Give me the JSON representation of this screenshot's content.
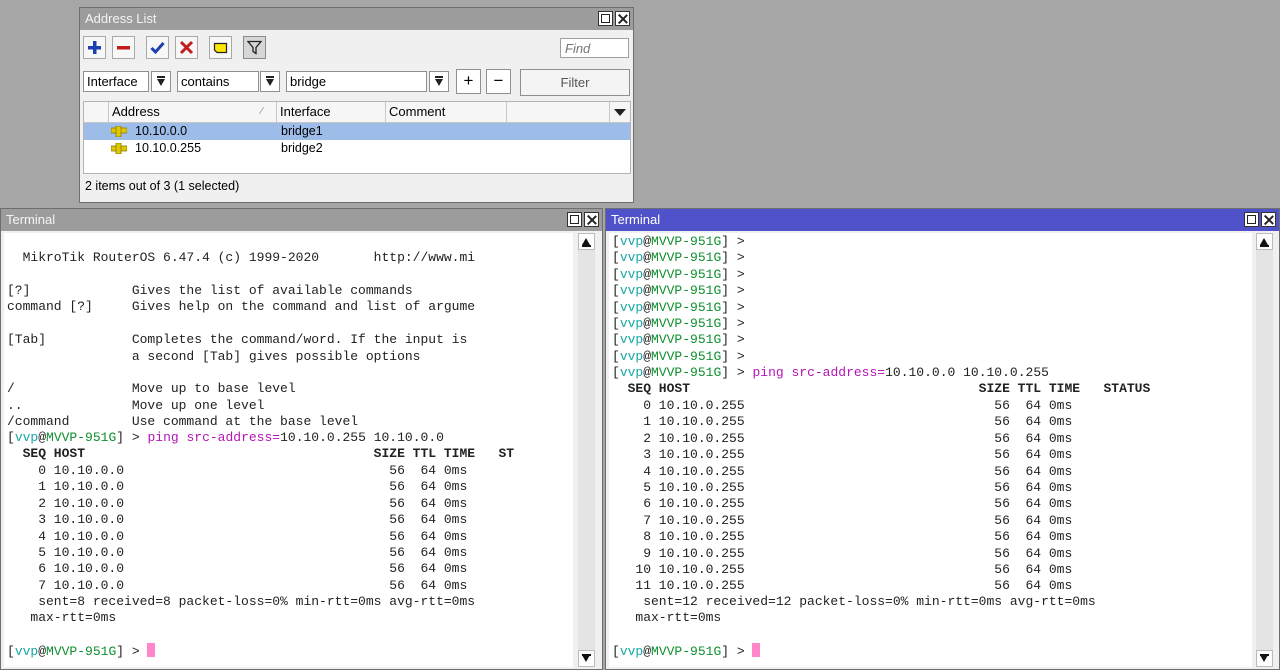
{
  "address_list": {
    "title": "Address List",
    "find_placeholder": "Find",
    "filter": {
      "field": "Interface",
      "operator": "contains",
      "value": "bridge",
      "plus": "+",
      "minus": "−",
      "button": "Filter"
    },
    "columns": [
      "Address",
      "Interface",
      "Comment"
    ],
    "rows": [
      {
        "address": "10.10.0.0",
        "interface": "bridge1",
        "comment": "",
        "selected": true
      },
      {
        "address": "10.10.0.255",
        "interface": "bridge2",
        "comment": "",
        "selected": false
      }
    ],
    "status": "2 items out of 3 (1 selected)"
  },
  "terminal_left": {
    "title": "Terminal",
    "banner": "  MikroTik RouterOS 6.47.4 (c) 1999-2020       http://www.mi",
    "help": [
      "[?]             Gives the list of available commands",
      "command [?]     Gives help on the command and list of argume",
      "",
      "[Tab]           Completes the command/word. If the input is",
      "                a second [Tab] gives possible options",
      "",
      "/               Move up to base level",
      "..              Move up one level",
      "/command        Use command at the base level"
    ],
    "prompt_user": "vvp",
    "prompt_host": "MVVP-951G",
    "command": "ping src-address=",
    "command_args": "10.10.0.255 10.10.0.0",
    "header": "  SEQ HOST                                     SIZE TTL TIME   ST",
    "ping_rows": [
      "    0 10.10.0.0                                  56  64 0ms",
      "    1 10.10.0.0                                  56  64 0ms",
      "    2 10.10.0.0                                  56  64 0ms",
      "    3 10.10.0.0                                  56  64 0ms",
      "    4 10.10.0.0                                  56  64 0ms",
      "    5 10.10.0.0                                  56  64 0ms",
      "    6 10.10.0.0                                  56  64 0ms",
      "    7 10.10.0.0                                  56  64 0ms"
    ],
    "summary1": "    sent=8 received=8 packet-loss=0% min-rtt=0ms avg-rtt=0ms",
    "summary2": "   max-rtt=0ms"
  },
  "terminal_right": {
    "title": "Terminal",
    "prompt_user": "vvp",
    "prompt_host": "MVVP-951G",
    "empty_prompts": 8,
    "command": "ping src-address=",
    "command_args": "10.10.0.0 10.10.0.255",
    "header": "  SEQ HOST                                     SIZE TTL TIME   STATUS",
    "ping_rows": [
      "    0 10.10.0.255                                56  64 0ms",
      "    1 10.10.0.255                                56  64 0ms",
      "    2 10.10.0.255                                56  64 0ms",
      "    3 10.10.0.255                                56  64 0ms",
      "    4 10.10.0.255                                56  64 0ms",
      "    5 10.10.0.255                                56  64 0ms",
      "    6 10.10.0.255                                56  64 0ms",
      "    7 10.10.0.255                                56  64 0ms",
      "    8 10.10.0.255                                56  64 0ms",
      "    9 10.10.0.255                                56  64 0ms",
      "   10 10.10.0.255                                56  64 0ms",
      "   11 10.10.0.255                                56  64 0ms"
    ],
    "summary1": "    sent=12 received=12 packet-loss=0% min-rtt=0ms avg-rtt=0ms",
    "summary2": "   max-rtt=0ms"
  },
  "colors": {
    "active_titlebar": "#4f52c8",
    "inactive_titlebar": "#9c9c9c",
    "selected_row": "#9dbde8",
    "cursor": "#ff86c8"
  }
}
